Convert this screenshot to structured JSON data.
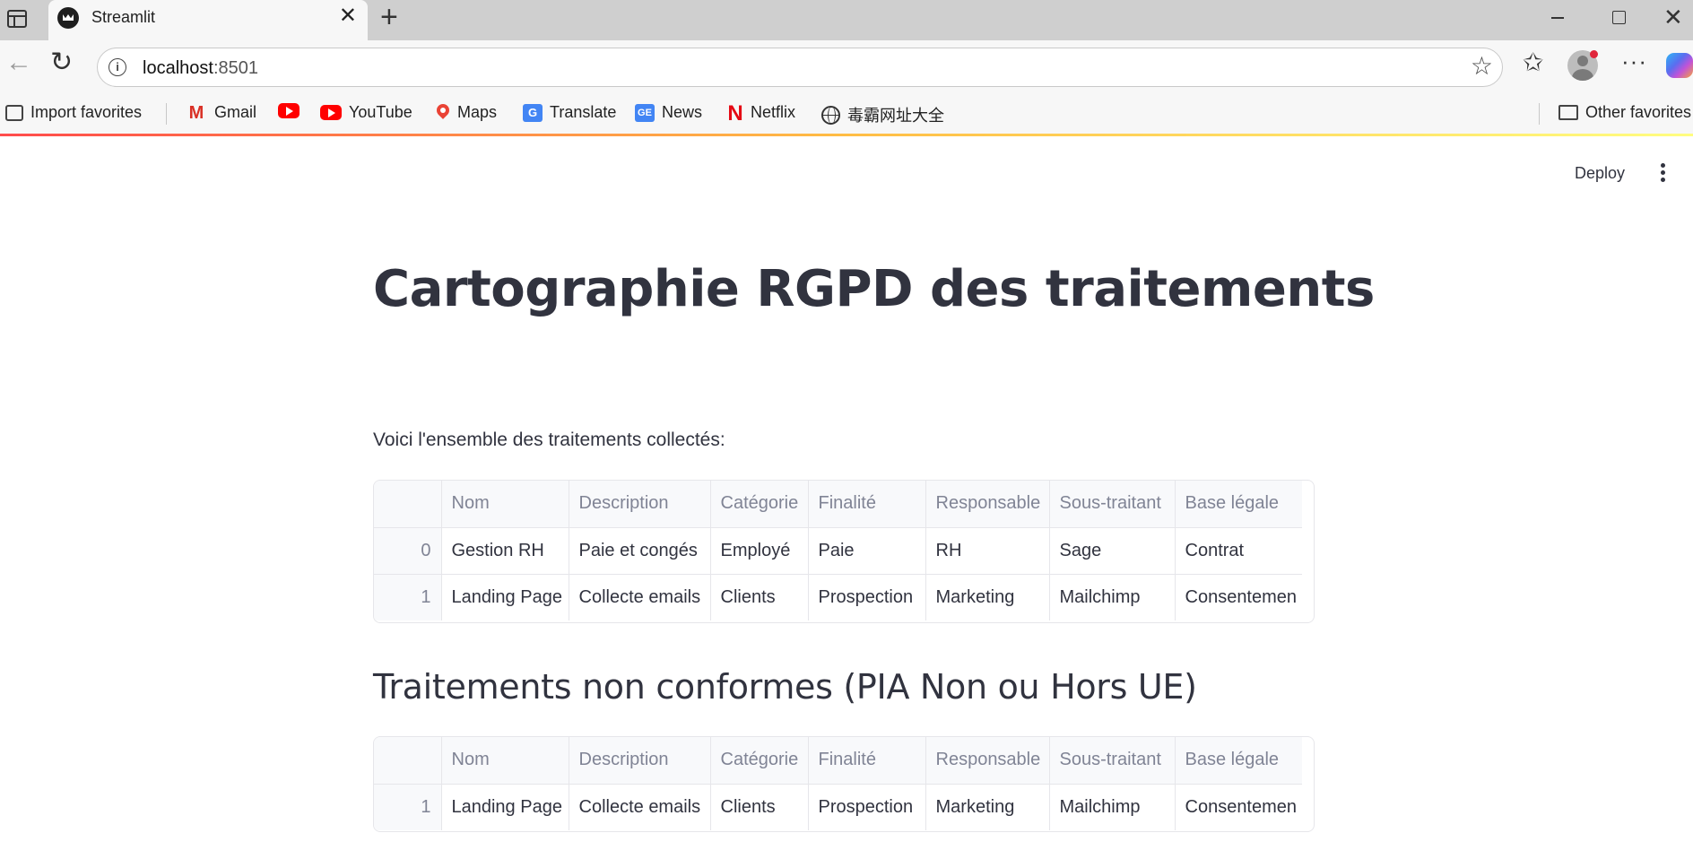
{
  "browser": {
    "tab_title": "Streamlit",
    "tab_close": "✕",
    "new_tab": "+",
    "url_host": "localhost",
    "url_port": ":8501",
    "window_controls": {
      "minimize": "—",
      "maximize": "□",
      "close": "✕"
    },
    "bookmarks": [
      {
        "label": "Import favorites",
        "icon": "import-icon"
      },
      {
        "label": "Gmail",
        "icon": "gmail-icon"
      },
      {
        "label": "",
        "icon": "youtube-icon"
      },
      {
        "label": "YouTube",
        "icon": "youtube-icon"
      },
      {
        "label": "Maps",
        "icon": "maps-icon"
      },
      {
        "label": "Translate",
        "icon": "translate-icon"
      },
      {
        "label": "News",
        "icon": "news-icon"
      },
      {
        "label": "Netflix",
        "icon": "netflix-icon"
      },
      {
        "label": "毒霸网址大全",
        "icon": "globe-icon"
      }
    ],
    "other_favorites": "Other favorites",
    "accent_gradient": [
      "#ff4b4b",
      "#ffbd45",
      "#fffd80"
    ]
  },
  "app": {
    "deploy_label": "Deploy",
    "title": "Cartographie RGPD des traitements",
    "intro": "Voici l'ensemble des traitements collectés:",
    "subheader": "Traitements non conformes (PIA Non ou Hors UE)",
    "columns": [
      "",
      "Nom",
      "Description",
      "Catégorie",
      "Finalité",
      "Responsable",
      "Sous-traitant",
      "Base légale"
    ],
    "table_all": [
      [
        "0",
        "Gestion RH",
        "Paie et congés",
        "Employé",
        "Paie",
        "RH",
        "Sage",
        "Contrat"
      ],
      [
        "1",
        "Landing Page",
        "Collecte emails",
        "Clients",
        "Prospection",
        "Marketing",
        "Mailchimp",
        "Consentemen"
      ]
    ],
    "table_noncompliant": [
      [
        "1",
        "Landing Page",
        "Collecte emails",
        "Clients",
        "Prospection",
        "Marketing",
        "Mailchimp",
        "Consentemen"
      ]
    ],
    "text_color": "#31333f",
    "muted_color": "#808495"
  }
}
